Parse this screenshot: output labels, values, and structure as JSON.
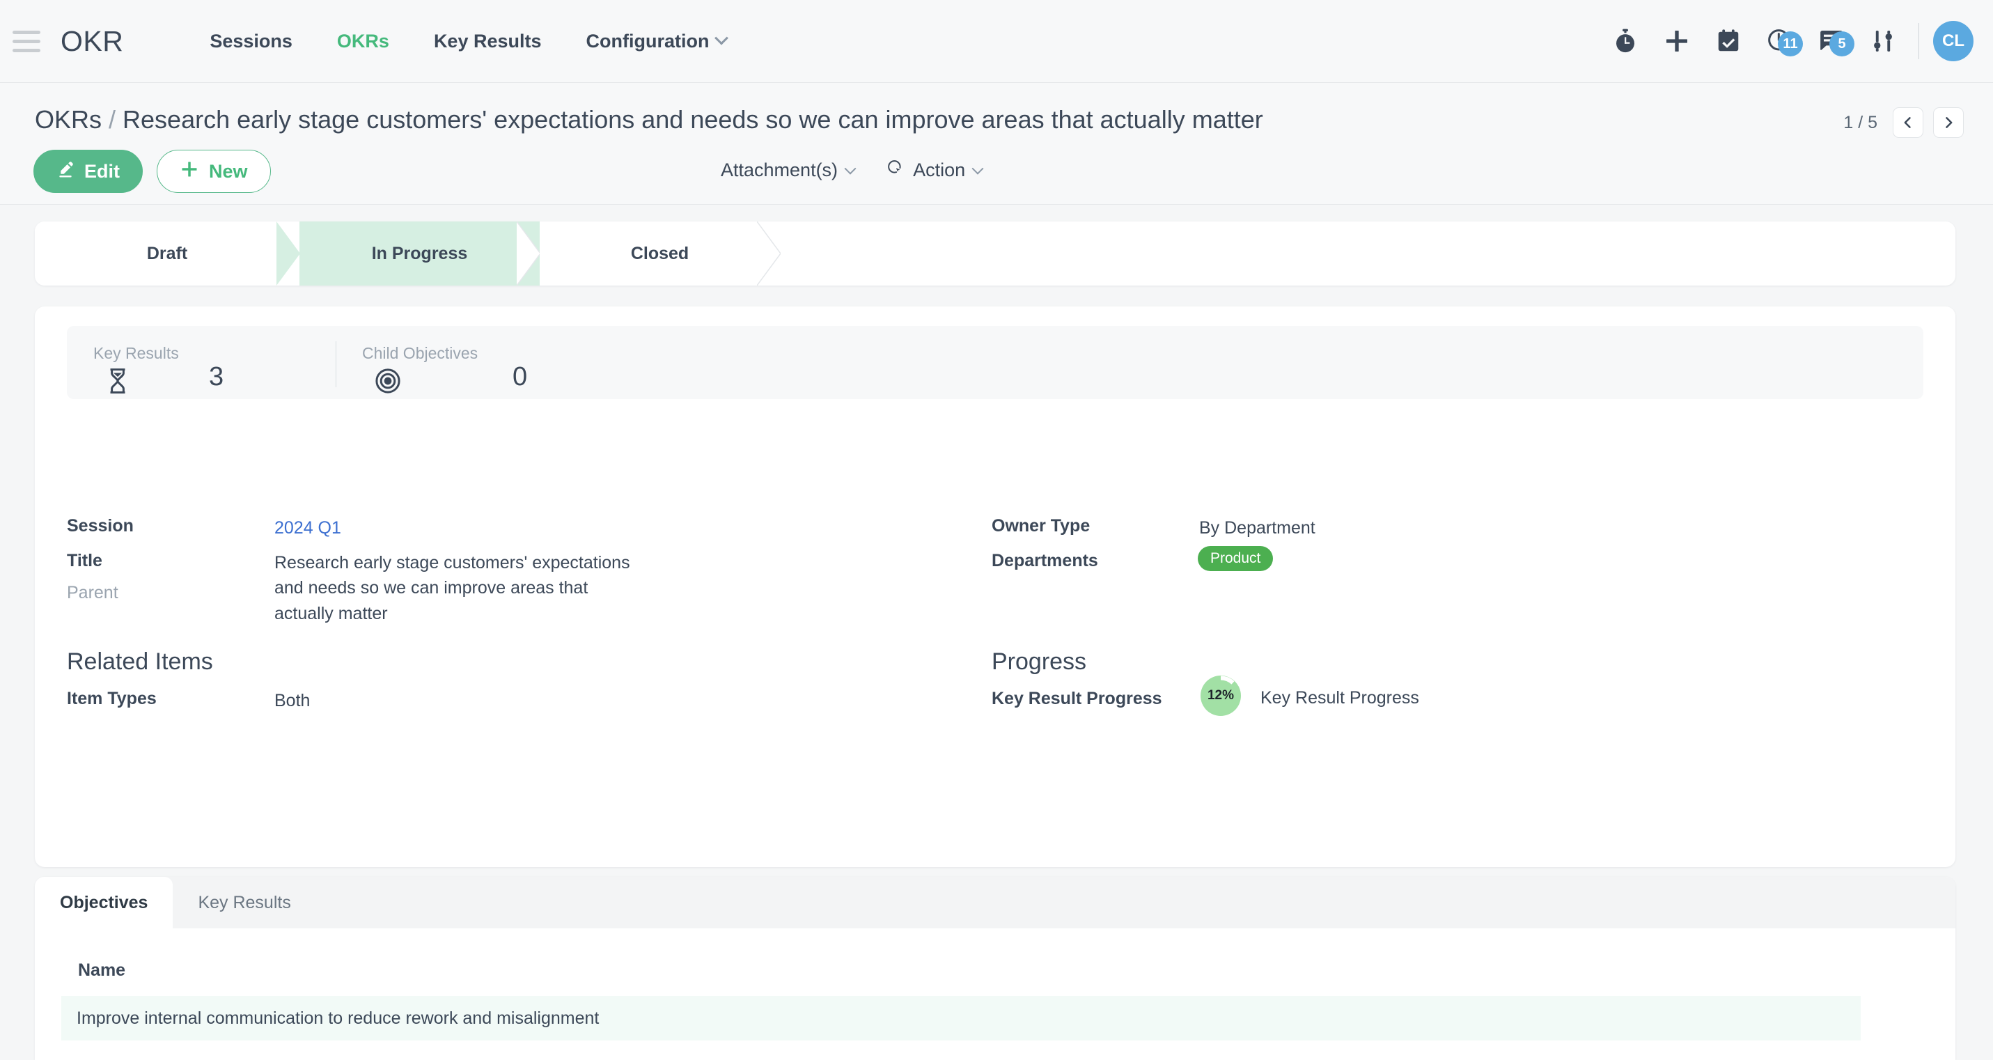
{
  "topbar": {
    "brand": "OKR",
    "menu": [
      {
        "label": "Sessions",
        "active": false,
        "dropdown": false
      },
      {
        "label": "OKRs",
        "active": true,
        "dropdown": false
      },
      {
        "label": "Key Results",
        "active": false,
        "dropdown": false
      },
      {
        "label": "Configuration",
        "active": false,
        "dropdown": true
      }
    ],
    "icons": [
      {
        "name": "stopwatch-icon",
        "badge": ""
      },
      {
        "name": "plus-icon",
        "badge": ""
      },
      {
        "name": "calendar-check-icon",
        "badge": ""
      },
      {
        "name": "clock-activity-icon",
        "badge": "11"
      },
      {
        "name": "messages-icon",
        "badge": "5"
      },
      {
        "name": "sliders-settings-icon",
        "badge": ""
      }
    ],
    "avatar_initials": "CL"
  },
  "header": {
    "breadcrumb_root": "OKRs",
    "breadcrumb_separator": "/",
    "breadcrumb_current": "Research early stage customers' expectations and needs so we can improve areas that actually matter",
    "edit_label": "Edit",
    "new_label": "New",
    "attachments_label": "Attachment(s)",
    "action_label": "Action",
    "pager_count": "1 / 5"
  },
  "statusbar": {
    "steps": [
      {
        "label": "Draft",
        "active": false
      },
      {
        "label": "In Progress",
        "active": true
      },
      {
        "label": "Closed",
        "active": false
      }
    ]
  },
  "stats": [
    {
      "label": "Key Results",
      "value": "3",
      "icon": "hourglass-icon"
    },
    {
      "label": "Child Objectives",
      "value": "0",
      "icon": "target-icon"
    }
  ],
  "details": {
    "session_label": "Session",
    "session_value": "2024 Q1",
    "title_label": "Title",
    "title_value": "Research early stage customers' expectations and needs so we can improve areas that actually matter",
    "parent_label": "Parent",
    "parent_value": "",
    "owner_type_label": "Owner Type",
    "owner_type_value": "By Department",
    "departments_label": "Departments",
    "departments_value": "Product"
  },
  "related_items": {
    "section_title": "Related Items",
    "item_types_label": "Item Types",
    "item_types_value": "Both"
  },
  "progress": {
    "section_title": "Progress",
    "key_result_progress_label": "Key Result Progress",
    "gauge_value": "12%",
    "gauge_percent": 12,
    "gauge_caption": "Key Result Progress"
  },
  "tabs": [
    {
      "label": "Objectives",
      "active": true
    },
    {
      "label": "Key Results",
      "active": false
    }
  ],
  "table": {
    "columns": [
      "Name"
    ],
    "rows": [
      {
        "name": "Improve internal communication to reduce rework and misalignment"
      }
    ]
  },
  "colors": {
    "accent_green": "#56b88a",
    "nav_active_green": "#45b97c",
    "tag_green": "#4caf50",
    "badge_blue": "#5ba9e0",
    "link_blue": "#3c6fd0",
    "step_active_bg": "#d6efe2",
    "row_highlight": "#f2faf7",
    "page_bg": "#f5f6f7"
  }
}
